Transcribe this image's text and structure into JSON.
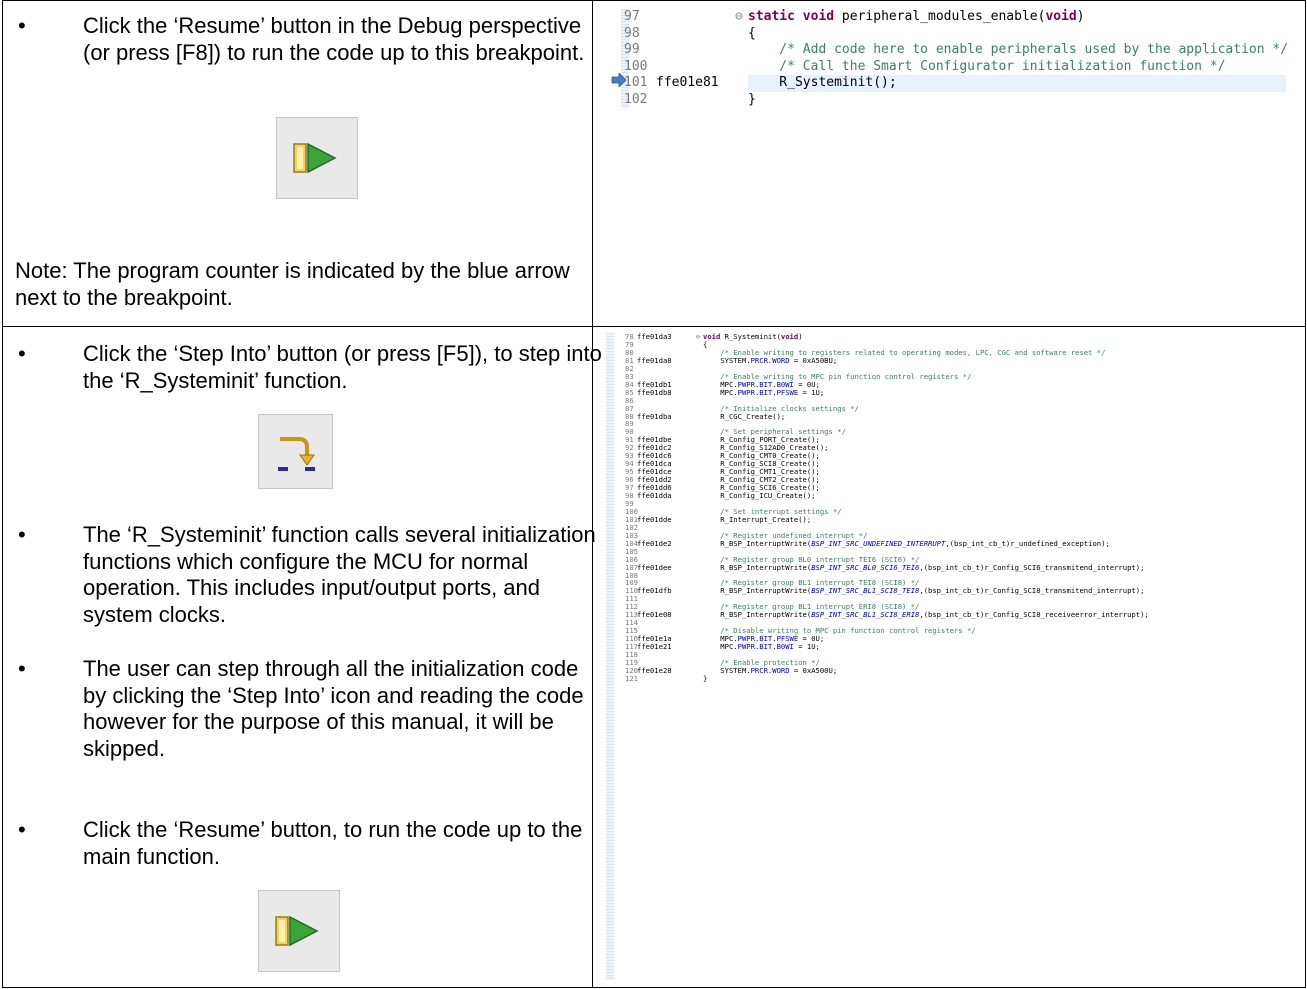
{
  "rows": [
    {
      "bullets": [
        "Click the ‘Resume’ button in the Debug perspective (or press [F8]) to run the code up to this breakpoint."
      ],
      "note": "Note: The program counter is indicated by the blue arrow next to the breakpoint.",
      "icon": "resume-icon"
    },
    {
      "bullets": [
        "Click the ‘Step Into’ button (or press [F5]), to step into the ‘R_Systeminit’ function.",
        "The ‘R_Systeminit’ function calls several initialization functions which configure the MCU for normal operation.  This includes input/output ports, and system clocks.",
        "The user can step through all the initialization code by clicking the ‘Step Into’ icon and reading the code however for the purpose of this manual, it will be skipped.",
        "Click the ‘Resume’ button, to run the code up to the main function."
      ],
      "icons": [
        "step-into-icon",
        "resume-icon"
      ]
    }
  ],
  "code1": {
    "lines": [
      {
        "num": "97",
        "addr": "",
        "code": "static void peripheral_modules_enable(void)"
      },
      {
        "num": "98",
        "addr": "",
        "code": "{"
      },
      {
        "num": "99",
        "addr": "",
        "code": "    /* Add code here to enable peripherals used by the application */"
      },
      {
        "num": "100",
        "addr": "",
        "code": "    /* Call the Smart Configurator initialization function */"
      },
      {
        "num": "101",
        "addr": "ffe01e81",
        "code": "    R_Systeminit();"
      },
      {
        "num": "102",
        "addr": "",
        "code": "}"
      }
    ]
  },
  "code2": {
    "lines": [
      {
        "num": "78",
        "addr": "ffe01da3",
        "code": "void R_Systeminit(void)"
      },
      {
        "num": "79",
        "addr": "",
        "code": "{"
      },
      {
        "num": "80",
        "addr": "",
        "code": "    /* Enable writing to registers related to operating modes, LPC, CGC and software reset */"
      },
      {
        "num": "81",
        "addr": "ffe01da8",
        "code": "    SYSTEM.PRCR.WORD = 0xA50BU;"
      },
      {
        "num": "82",
        "addr": "",
        "code": ""
      },
      {
        "num": "83",
        "addr": "",
        "code": "    /* Enable writing to MPC pin function control registers */"
      },
      {
        "num": "84",
        "addr": "ffe01db1",
        "code": "    MPC.PWPR.BIT.B0WI = 0U;"
      },
      {
        "num": "85",
        "addr": "ffe01db8",
        "code": "    MPC.PWPR.BIT.PFSWE = 1U;"
      },
      {
        "num": "86",
        "addr": "",
        "code": ""
      },
      {
        "num": "87",
        "addr": "",
        "code": "    /* Initialize clocks settings */"
      },
      {
        "num": "88",
        "addr": "ffe01dba",
        "code": "    R_CGC_Create();"
      },
      {
        "num": "89",
        "addr": "",
        "code": ""
      },
      {
        "num": "90",
        "addr": "",
        "code": "    /* Set peripheral settings */"
      },
      {
        "num": "91",
        "addr": "ffe01dbe",
        "code": "    R_Config_PORT_Create();"
      },
      {
        "num": "92",
        "addr": "ffe01dc2",
        "code": "    R_Config_S12AD0_Create();"
      },
      {
        "num": "93",
        "addr": "ffe01dc6",
        "code": "    R_Config_CMT0_Create();"
      },
      {
        "num": "94",
        "addr": "ffe01dca",
        "code": "    R_Config_SCI8_Create();"
      },
      {
        "num": "95",
        "addr": "ffe01dce",
        "code": "    R_Config_CMT1_Create();"
      },
      {
        "num": "96",
        "addr": "ffe01dd2",
        "code": "    R_Config_CMT2_Create();"
      },
      {
        "num": "97",
        "addr": "ffe01dd6",
        "code": "    R_Config_SCI6_Create();"
      },
      {
        "num": "98",
        "addr": "ffe01dda",
        "code": "    R_Config_ICU_Create();"
      },
      {
        "num": "99",
        "addr": "",
        "code": ""
      },
      {
        "num": "100",
        "addr": "",
        "code": "    /* Set interrupt settings */"
      },
      {
        "num": "101",
        "addr": "ffe01dde",
        "code": "    R_Interrupt_Create();"
      },
      {
        "num": "102",
        "addr": "",
        "code": ""
      },
      {
        "num": "103",
        "addr": "",
        "code": "    /* Register undefined interrupt */"
      },
      {
        "num": "104",
        "addr": "ffe01de2",
        "code": "    R_BSP_InterruptWrite(BSP_INT_SRC_UNDEFINED_INTERRUPT,(bsp_int_cb_t)r_undefined_exception);"
      },
      {
        "num": "105",
        "addr": "",
        "code": ""
      },
      {
        "num": "106",
        "addr": "",
        "code": "    /* Register group BL0 interrupt TEI6 (SCI6) */"
      },
      {
        "num": "107",
        "addr": "ffe01dee",
        "code": "    R_BSP_InterruptWrite(BSP_INT_SRC_BL0_SCI6_TEI6,(bsp_int_cb_t)r_Config_SCI6_transmitend_interrupt);"
      },
      {
        "num": "108",
        "addr": "",
        "code": ""
      },
      {
        "num": "109",
        "addr": "",
        "code": "    /* Register group BL1 interrupt TEI8 (SCI8) */"
      },
      {
        "num": "110",
        "addr": "ffe01dfb",
        "code": "    R_BSP_InterruptWrite(BSP_INT_SRC_BL1_SCI8_TEI8,(bsp_int_cb_t)r_Config_SCI8_transmitend_interrupt);"
      },
      {
        "num": "111",
        "addr": "",
        "code": ""
      },
      {
        "num": "112",
        "addr": "",
        "code": "    /* Register group BL1 interrupt ERI8 (SCI8) */"
      },
      {
        "num": "113",
        "addr": "ffe01e08",
        "code": "    R_BSP_InterruptWrite(BSP_INT_SRC_BL1_SCI8_ERI8,(bsp_int_cb_t)r_Config_SCI8_receiveerror_interrupt);"
      },
      {
        "num": "114",
        "addr": "",
        "code": ""
      },
      {
        "num": "115",
        "addr": "",
        "code": "    /* Disable writing to MPC pin function control registers */"
      },
      {
        "num": "116",
        "addr": "ffe01e1a",
        "code": "    MPC.PWPR.BIT.PFSWE = 0U;"
      },
      {
        "num": "117",
        "addr": "ffe01e21",
        "code": "    MPC.PWPR.BIT.B0WI = 1U;"
      },
      {
        "num": "118",
        "addr": "",
        "code": ""
      },
      {
        "num": "119",
        "addr": "",
        "code": "    /* Enable protection */"
      },
      {
        "num": "120",
        "addr": "ffe01e28",
        "code": "    SYSTEM.PRCR.WORD = 0xA500U;"
      },
      {
        "num": "121",
        "addr": "",
        "code": "}"
      }
    ]
  }
}
